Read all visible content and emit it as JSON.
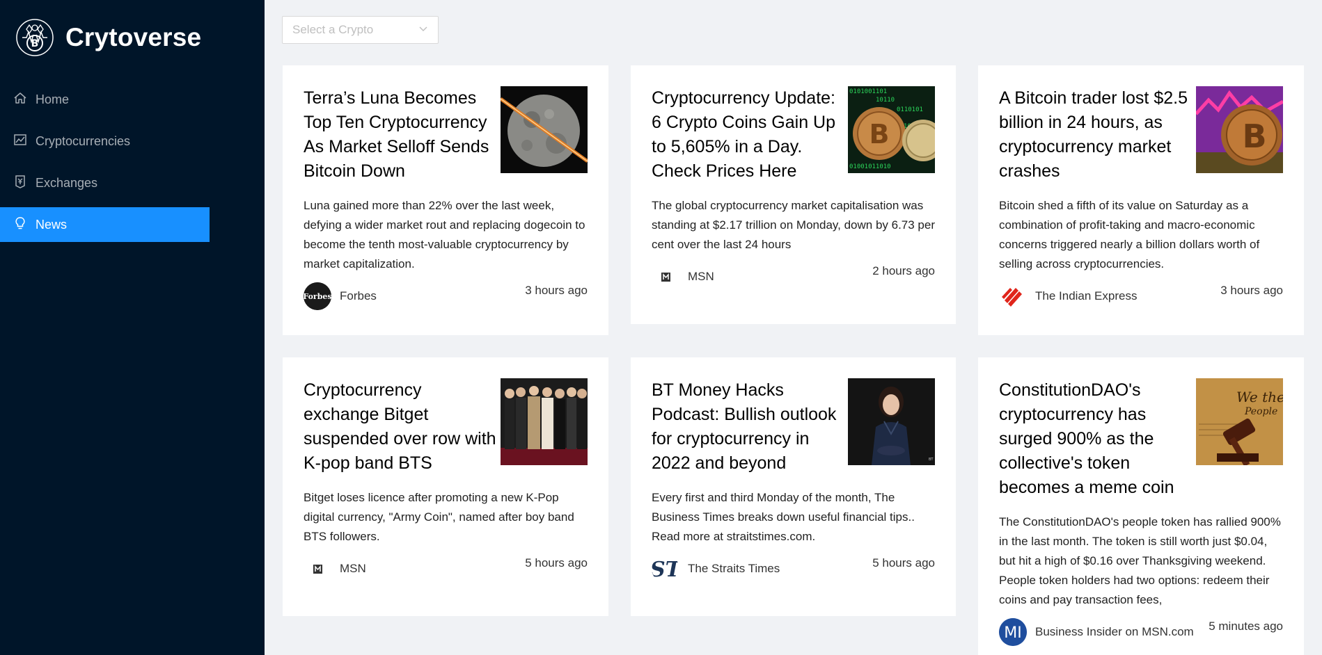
{
  "brand": {
    "name": "Crytoverse"
  },
  "menu": {
    "items": [
      {
        "label": "Home",
        "icon": "home-icon"
      },
      {
        "label": "Cryptocurrencies",
        "icon": "line-chart-icon"
      },
      {
        "label": "Exchanges",
        "icon": "money-collect-icon"
      },
      {
        "label": "News",
        "icon": "bulb-icon",
        "active": true
      }
    ]
  },
  "filter": {
    "placeholder": "Select a Crypto"
  },
  "colors": {
    "sidebar": "#001529",
    "accent": "#1890ff",
    "background": "#f0f2f5"
  },
  "news": [
    {
      "title": "Terra’s Luna Becomes Top Ten Cryptocurrency As Market Selloff Sends Bitcoin Down",
      "description": "Luna gained more than 22% over the last week, defying a wider market rout and replacing dogecoin to become the tenth most-valuable cryptocurrency by market capitalization.",
      "provider": "Forbes",
      "time": "3 hours ago",
      "thumb": "moon-image",
      "avatar": "forbes-avatar"
    },
    {
      "title": "Cryptocurrency Update: 6 Crypto Coins Gain Up to 5,605% in a Day. Check Prices Here",
      "description": "The global cryptocurrency market capitalisation was standing at $2.17 trillion on Monday, down by 6.73 per cent over the last 24 hours",
      "provider": "MSN",
      "time": "2 hours ago",
      "thumb": "bitcoin-coins-image",
      "avatar": "msn-avatar"
    },
    {
      "title": "A Bitcoin trader lost $2.5 billion in 24 hours, as cryptocurrency market crashes",
      "description": "Bitcoin shed a fifth of its value on Saturday as a combination of profit-taking and macro-economic concerns triggered nearly a billion dollars worth of selling across cryptocurrencies.",
      "provider": "The Indian Express",
      "time": "3 hours ago",
      "thumb": "bitcoin-chart-image",
      "avatar": "indian-express-avatar"
    },
    {
      "title": "Cryptocurrency exchange Bitget suspended over row with K-pop band BTS",
      "description": "Bitget loses licence after promoting a new K-Pop digital currency, \"Army Coin\", named after boy band BTS followers.",
      "provider": "MSN",
      "time": "5 hours ago",
      "thumb": "bts-band-image",
      "avatar": "msn-avatar"
    },
    {
      "title": "BT Money Hacks Podcast: Bullish outlook for cryptocurrency in 2022 and beyond",
      "description": "Every first and third Monday of the month, The Business Times breaks down useful financial tips.. Read more at straitstimes.com.",
      "provider": "The Straits Times",
      "time": "5 hours ago",
      "thumb": "podcast-guest-image",
      "avatar": "straits-times-avatar"
    },
    {
      "title": "ConstitutionDAO's cryptocurrency has surged 900% as the collective's token becomes a meme coin",
      "description": "The ConstitutionDAO's people token has rallied 900% in the last month. The token is still worth just $0.04, but hit a high of $0.16 over Thanksgiving weekend. People token holders had two options: redeem their coins and pay transaction fees,",
      "provider": "Business Insider on MSN.com",
      "time": "5 minutes ago",
      "thumb": "constitution-gavel-image",
      "avatar": "business-insider-avatar",
      "avatar_text": "MI"
    }
  ]
}
